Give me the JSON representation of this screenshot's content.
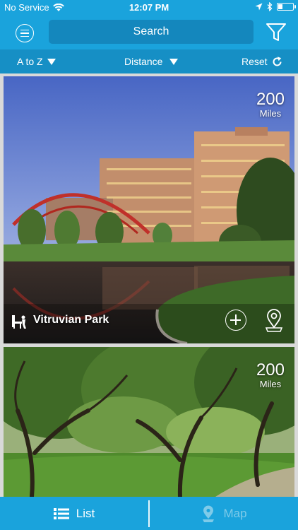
{
  "status_bar": {
    "carrier": "No Service",
    "time": "12:07 PM",
    "battery_level": 0.25
  },
  "header": {
    "search_label": "Search",
    "menu_icon": "menu-icon",
    "filter_icon": "filter-icon"
  },
  "sort_bar": {
    "sort_label": "A to Z",
    "distance_label": "Distance",
    "reset_label": "Reset"
  },
  "cards": [
    {
      "distance_value": "200",
      "distance_unit": "Miles",
      "name": "Vitruvian Park",
      "icon": "park-bench-icon"
    },
    {
      "distance_value": "200",
      "distance_unit": "Miles"
    }
  ],
  "tabs": {
    "list_label": "List",
    "map_label": "Map",
    "active": "List"
  },
  "colors": {
    "primary": "#1aa3dc",
    "sort_bar": "#168fc5",
    "search_box": "#1487bd",
    "inactive_tab_text": "#7fcbe9"
  }
}
